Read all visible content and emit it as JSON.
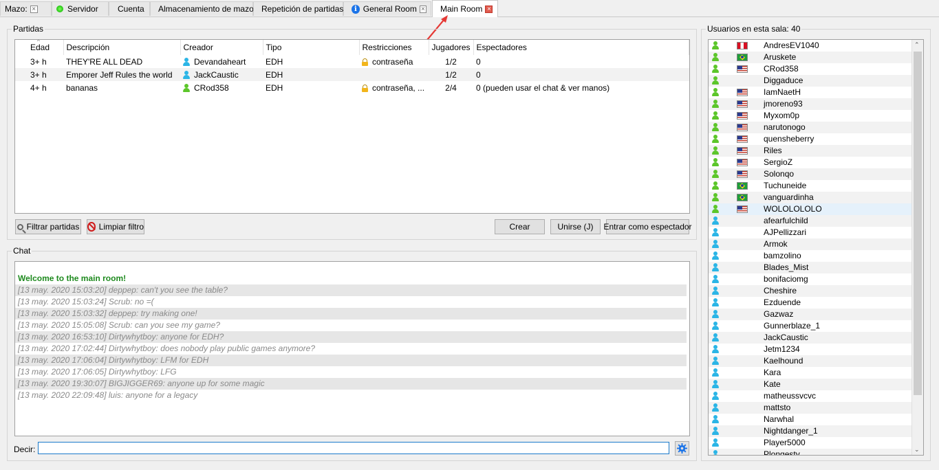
{
  "tabs": [
    {
      "label": "Mazo:",
      "close": "×"
    },
    {
      "label": "Servidor"
    },
    {
      "label": "Cuenta"
    },
    {
      "label": "Almacenamiento de mazos"
    },
    {
      "label": "Repetición de partidas"
    },
    {
      "label": "General Room",
      "close": "×"
    },
    {
      "label": "Main Room",
      "close": "×"
    }
  ],
  "games": {
    "title": "Partidas",
    "columns": [
      "Edad",
      "Descripción",
      "Creador",
      "Tipo",
      "Restricciones",
      "Jugadores",
      "Espectadores"
    ],
    "rows": [
      {
        "age": "3+ h",
        "description": "THEY'RE ALL DEAD",
        "creator": "Devandaheart",
        "creator_icon": "blue",
        "type": "EDH",
        "restrictions": "contraseña",
        "locked": true,
        "players": "1/2",
        "spectators": "0"
      },
      {
        "age": "3+ h",
        "description": "Emporer Jeff Rules the world",
        "creator": "JackCaustic",
        "creator_icon": "blue",
        "type": "EDH",
        "restrictions": "",
        "locked": false,
        "players": "1/2",
        "spectators": "0"
      },
      {
        "age": "4+ h",
        "description": "bananas",
        "creator": "CRod358",
        "creator_icon": "green",
        "type": "EDH",
        "restrictions": "contraseña, ...",
        "locked": true,
        "players": "2/4",
        "spectators": "0 (pueden usar el chat & ver manos)"
      }
    ],
    "buttons": {
      "filter": "Filtrar partidas",
      "clear_filter": "Limpiar filtro",
      "create": "Crear",
      "join": "Unirse (J)",
      "spectate": "Entrar como espectador"
    }
  },
  "chat": {
    "title": "Chat",
    "welcome": "Welcome to the main room!",
    "messages": [
      "[13 may. 2020 15:03:20] deppep: can't you see the table?",
      "[13 may. 2020 15:03:24] Scrub: no =(",
      "[13 may. 2020 15:03:32] deppep: try making one!",
      "[13 may. 2020 15:05:08] Scrub: can you see my game?",
      "[13 may. 2020 16:53:10] Dirtywhytboy: anyone for EDH?",
      "[13 may. 2020 17:02:44] Dirtywhytboy: does nobody play public games anymore?",
      "[13 may. 2020 17:06:04] Dirtywhytboy: LFM for EDH",
      "[13 may. 2020 17:06:05] Dirtywhytboy: LFG",
      "[13 may. 2020 19:30:07] BIGJIGGER69: anyone up for some magic",
      "[13 may. 2020 22:09:48] luis: anyone for a legacy"
    ],
    "say_label": "Decir:",
    "input_value": ""
  },
  "users": {
    "title": "Usuarios en esta sala: 40",
    "list": [
      {
        "name": "AndresEV1040",
        "icon": "green",
        "flag": "pe"
      },
      {
        "name": "Aruskete",
        "icon": "green",
        "flag": "br"
      },
      {
        "name": "CRod358",
        "icon": "green",
        "flag": "us"
      },
      {
        "name": "Diggaduce",
        "icon": "green",
        "flag": ""
      },
      {
        "name": "IamNaetH",
        "icon": "green",
        "flag": "us"
      },
      {
        "name": "jmoreno93",
        "icon": "green",
        "flag": "us"
      },
      {
        "name": "Myxom0p",
        "icon": "green",
        "flag": "us"
      },
      {
        "name": "narutonogo",
        "icon": "green",
        "flag": "us"
      },
      {
        "name": "quensheberry",
        "icon": "green",
        "flag": "us"
      },
      {
        "name": "Riles",
        "icon": "green",
        "flag": "us"
      },
      {
        "name": "SergioZ",
        "icon": "green",
        "flag": "us"
      },
      {
        "name": "Solonqo",
        "icon": "green",
        "flag": "us"
      },
      {
        "name": "Tuchuneide",
        "icon": "green",
        "flag": "br"
      },
      {
        "name": "vanguardinha",
        "icon": "green",
        "flag": "br"
      },
      {
        "name": "WOLOLOLOLO",
        "icon": "green",
        "flag": "us"
      },
      {
        "name": "afearfulchild",
        "icon": "blue",
        "flag": ""
      },
      {
        "name": "AJPellizzari",
        "icon": "blue",
        "flag": ""
      },
      {
        "name": "Armok",
        "icon": "blue",
        "flag": ""
      },
      {
        "name": "bamzolino",
        "icon": "blue",
        "flag": ""
      },
      {
        "name": "Blades_Mist",
        "icon": "blue",
        "flag": ""
      },
      {
        "name": "bonifaciomg",
        "icon": "blue",
        "flag": ""
      },
      {
        "name": "Cheshire",
        "icon": "blue",
        "flag": ""
      },
      {
        "name": "Ezduende",
        "icon": "blue",
        "flag": ""
      },
      {
        "name": "Gazwaz",
        "icon": "blue",
        "flag": ""
      },
      {
        "name": "Gunnerblaze_1",
        "icon": "blue",
        "flag": ""
      },
      {
        "name": "JackCaustic",
        "icon": "blue",
        "flag": ""
      },
      {
        "name": "Jetm1234",
        "icon": "blue",
        "flag": ""
      },
      {
        "name": "Kaelhound",
        "icon": "blue",
        "flag": ""
      },
      {
        "name": "Kara",
        "icon": "blue",
        "flag": ""
      },
      {
        "name": "Kate",
        "icon": "blue",
        "flag": ""
      },
      {
        "name": "matheussvcvc",
        "icon": "blue",
        "flag": ""
      },
      {
        "name": "mattsto",
        "icon": "blue",
        "flag": ""
      },
      {
        "name": "Narwhal",
        "icon": "blue",
        "flag": ""
      },
      {
        "name": "Nightdanger_1",
        "icon": "blue",
        "flag": ""
      },
      {
        "name": "Player5000",
        "icon": "blue",
        "flag": ""
      },
      {
        "name": "Plongesty",
        "icon": "blue",
        "flag": ""
      }
    ],
    "selected_index": 14
  },
  "colors": {
    "accent_red": "#e53935",
    "welcome_green": "#1e8a1e",
    "user_green": "#5cc62a",
    "user_blue": "#2bb5e6"
  }
}
